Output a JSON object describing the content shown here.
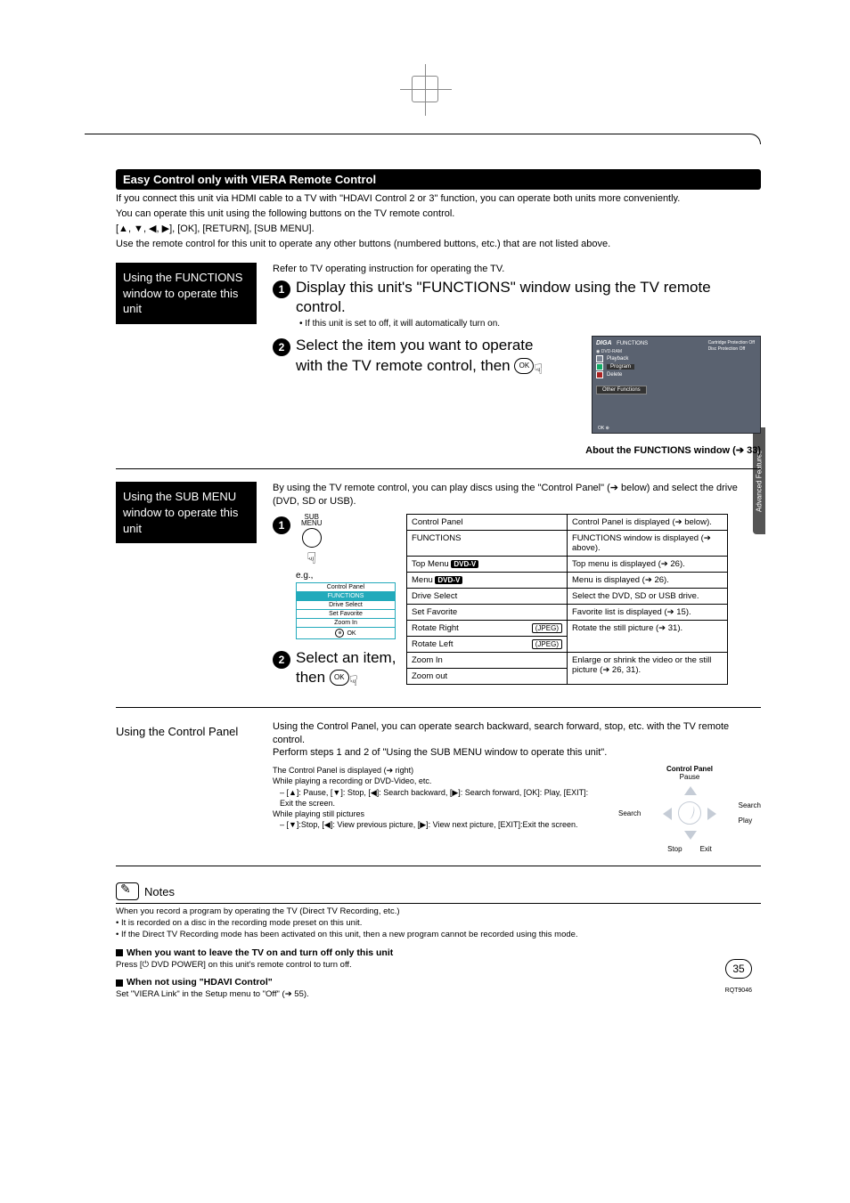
{
  "sideTab": "Advanced Features",
  "header": "Easy Control only with VIERA Remote Control",
  "intro": {
    "p1": "If you connect this unit via HDMI cable to a TV with \"HDAVI Control 2 or 3\" function, you can operate both units more conveniently.",
    "p2": "You can operate this unit using the following buttons on the TV remote control.",
    "p3": "[▲, ▼, ◀, ▶], [OK], [RETURN], [SUB MENU].",
    "p4": "Use the remote control for this unit to operate any other buttons (numbered buttons, etc.) that are not listed above."
  },
  "sect1": {
    "box": "Using the FUNCTIONS window to operate this unit",
    "refer": "Refer to TV operating instruction for operating the TV.",
    "step1": "Display this unit's \"FUNCTIONS\" window using the TV remote control.",
    "step1_bullet": "• If this unit is set to off, it will automatically turn on.",
    "step2": "Select the item you want to operate with the TV remote control, then ",
    "ok": "OK",
    "fw": {
      "brand": "DIGA",
      "funcs": "FUNCTIONS",
      "prot1": "Cartridge Protection  Off",
      "prot2": "Disc Protection  Off",
      "ram": "DVD-RAM",
      "i1": "Playback",
      "i2": "Program",
      "i3": "Delete",
      "other": "Other Functions",
      "foot": "OK"
    },
    "about": "About the FUNCTIONS window (➔ 33)"
  },
  "sect2": {
    "box": "Using the SUB MENU window to operate this unit",
    "intro": "By using the TV remote control, you can play discs using the \"Control Panel\" (➔ below) and select the drive (DVD, SD or USB).",
    "sub_label1": "SUB",
    "sub_label2": "MENU",
    "eg": "e.g.,",
    "menu": {
      "r1": "Control Panel",
      "r2": "FUNCTIONS",
      "r3": "Drive Select",
      "r4": "Set Favorite",
      "r5": "Zoom In",
      "ok": "OK"
    },
    "step2": "Select an item, then ",
    "table": [
      [
        "Control Panel",
        "Control Panel is displayed (➔ below)."
      ],
      [
        "FUNCTIONS",
        "FUNCTIONS window is displayed (➔ above)."
      ],
      [
        "Top Menu",
        "DVD-V",
        "Top menu is displayed (➔ 26)."
      ],
      [
        "Menu",
        "DVD-V",
        "Menu is displayed (➔ 26)."
      ],
      [
        "Drive Select",
        "Select the DVD, SD or USB drive."
      ],
      [
        "Set Favorite",
        "Favorite list is displayed (➔ 15)."
      ],
      [
        "Rotate Right",
        "(JPEG)",
        "Rotate the still picture (➔ 31)."
      ],
      [
        "Rotate Left",
        "(JPEG)",
        ""
      ],
      [
        "Zoom In",
        "Enlarge or shrink the video or the still picture (➔ 26, 31)."
      ],
      [
        "Zoom out",
        ""
      ]
    ]
  },
  "sect3": {
    "box": "Using the Control Panel",
    "p1": "Using the Control Panel, you can operate search backward, search forward, stop, etc. with the TV remote control.",
    "p2": "Perform steps 1 and 2 of \"Using the SUB MENU window to operate this unit\".",
    "t1": "The Control Panel is displayed (➔ right)",
    "t2": "While playing a recording or DVD-Video, etc.",
    "t3": "– [▲]: Pause, [▼]: Stop, [◀]: Search backward, [▶]: Search forward, [OK]: Play, [EXIT]: Exit the screen.",
    "t4": "While playing still pictures",
    "t5": "– [▼]:Stop, [◀]: View previous picture, [▶]: View next picture, [EXIT]:Exit the screen.",
    "d": {
      "title": "Control Panel",
      "up": "Pause",
      "down": "Stop",
      "left": "Search",
      "right": "Search",
      "play": "Play",
      "exit": "Exit"
    }
  },
  "notes": {
    "title": "Notes",
    "n1": "When you record a program by operating the TV (Direct TV Recording, etc.)",
    "n2": "• It is recorded on a disc in the recording mode preset on this unit.",
    "n3": "• If the Direct TV Recording mode has been activated on this unit, then a new program cannot be recorded using this mode.",
    "h1": "When you want to leave the TV on and turn off only this unit",
    "p1": "Press [⏻ DVD POWER] on this unit's remote control to turn off.",
    "h2": "When not using \"HDAVI Control\"",
    "p2": "Set \"VIERA Link\" in the Setup menu to \"Off\" (➔ 55)."
  },
  "pageNum": "35",
  "rqt": "RQT9046"
}
